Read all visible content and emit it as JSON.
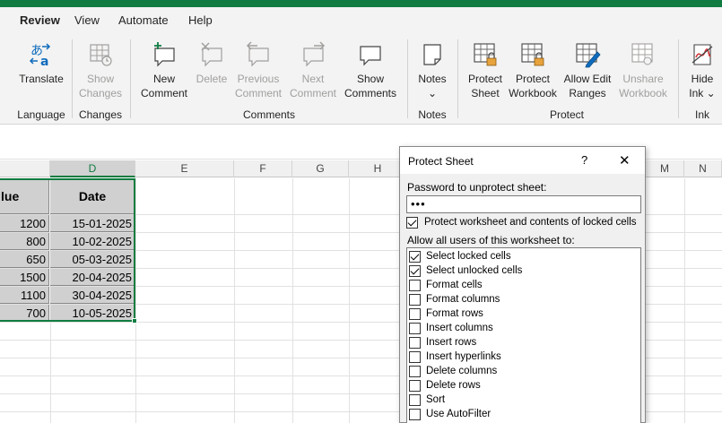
{
  "tabs": [
    {
      "label": "Review",
      "active": true
    },
    {
      "label": "View",
      "active": false
    },
    {
      "label": "Automate",
      "active": false
    },
    {
      "label": "Help",
      "active": false
    }
  ],
  "ribbon": {
    "language": {
      "group_label": "Language",
      "translate": "Translate"
    },
    "changes": {
      "group_label": "Changes",
      "show_changes_1": "Show",
      "show_changes_2": "Changes"
    },
    "comments": {
      "group_label": "Comments",
      "new_1": "New",
      "new_2": "Comment",
      "delete": "Delete",
      "previous_1": "Previous",
      "previous_2": "Comment",
      "next_1": "Next",
      "next_2": "Comment",
      "show_1": "Show",
      "show_2": "Comments"
    },
    "notes": {
      "group_label": "Notes",
      "notes": "Notes",
      "chevron": "⌄"
    },
    "protect": {
      "group_label": "Protect",
      "sheet_1": "Protect",
      "sheet_2": "Sheet",
      "workbook_1": "Protect",
      "workbook_2": "Workbook",
      "allow_1": "Allow Edit",
      "allow_2": "Ranges",
      "unshare_1": "Unshare",
      "unshare_2": "Workbook"
    },
    "ink": {
      "group_label": "Ink",
      "hide_1": "Hide",
      "hide_2": "Ink ⌄"
    }
  },
  "columns": [
    "D",
    "E",
    "F",
    "G",
    "H",
    "M",
    "N"
  ],
  "table": {
    "header_left": "lue",
    "header_date": "Date",
    "rows": [
      {
        "value": "1200",
        "date": "15-01-2025"
      },
      {
        "value": "800",
        "date": "10-02-2025"
      },
      {
        "value": "650",
        "date": "05-03-2025"
      },
      {
        "value": "1500",
        "date": "20-04-2025"
      },
      {
        "value": "1100",
        "date": "30-04-2025"
      },
      {
        "value": "700",
        "date": "10-05-2025"
      }
    ]
  },
  "dialog": {
    "title": "Protect Sheet",
    "help": "?",
    "close": "✕",
    "password_label": "Password to unprotect sheet:",
    "password_value": "•••",
    "protect_contents_label": "Protect worksheet and contents of locked cells",
    "allow_label": "Allow all users of this worksheet to:",
    "options": [
      {
        "label": "Select locked cells",
        "checked": true
      },
      {
        "label": "Select unlocked cells",
        "checked": true
      },
      {
        "label": "Format cells",
        "checked": false
      },
      {
        "label": "Format columns",
        "checked": false
      },
      {
        "label": "Format rows",
        "checked": false
      },
      {
        "label": "Insert columns",
        "checked": false
      },
      {
        "label": "Insert rows",
        "checked": false
      },
      {
        "label": "Insert hyperlinks",
        "checked": false
      },
      {
        "label": "Delete columns",
        "checked": false
      },
      {
        "label": "Delete rows",
        "checked": false
      },
      {
        "label": "Sort",
        "checked": false
      },
      {
        "label": "Use AutoFilter",
        "checked": false
      }
    ]
  },
  "colors": {
    "accent": "#107c41"
  }
}
